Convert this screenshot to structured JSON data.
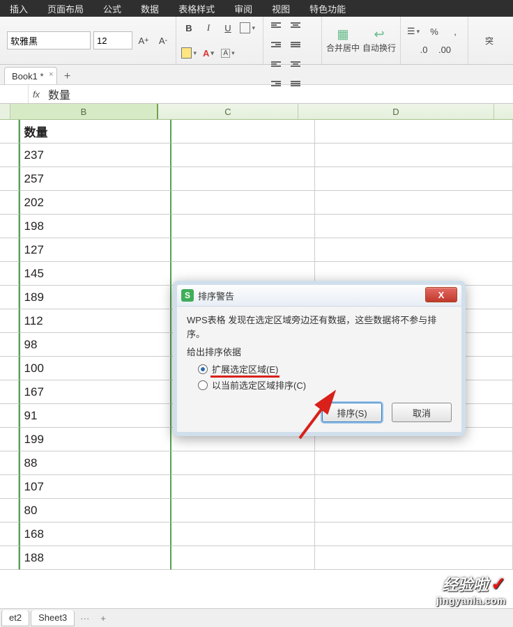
{
  "menu": {
    "items": [
      "插入",
      "页面布局",
      "公式",
      "数据",
      "表格样式",
      "审阅",
      "视图",
      "特色功能"
    ]
  },
  "ribbon": {
    "font_name": "软雅黑",
    "font_size": "12",
    "merge_label": "合并居中",
    "wrap_label": "自动换行",
    "percent": "%",
    "dec_inc": ".0",
    "dec_dec": ".00",
    "break": "突"
  },
  "doc": {
    "tab": "Book1 *",
    "add": "+"
  },
  "formula": {
    "addr": "",
    "fx": "fx",
    "value": "数量"
  },
  "columns": {
    "a": "",
    "b": "B",
    "c": "C",
    "d": "D"
  },
  "table": {
    "header": "数量",
    "rows": [
      "237",
      "257",
      "202",
      "198",
      "127",
      "145",
      "189",
      "112",
      "98",
      "100",
      "167",
      "91",
      "199",
      "88",
      "107",
      "80",
      "168",
      "188"
    ]
  },
  "dialog": {
    "title": "排序警告",
    "icon": "S",
    "message": "WPS表格 发现在选定区域旁边还有数据，这些数据将不参与排序。",
    "group_title": "给出排序依据",
    "opt1": "扩展选定区域(E)",
    "opt2": "以当前选定区域排序(C)",
    "ok": "排序(S)",
    "cancel": "取消",
    "close": "X"
  },
  "sheets": {
    "t2": "et2",
    "t3": "Sheet3",
    "more": "···",
    "add": "+"
  },
  "watermark": {
    "t1": "经验啦",
    "t2": "jingyanla.com",
    "check": "✓"
  }
}
